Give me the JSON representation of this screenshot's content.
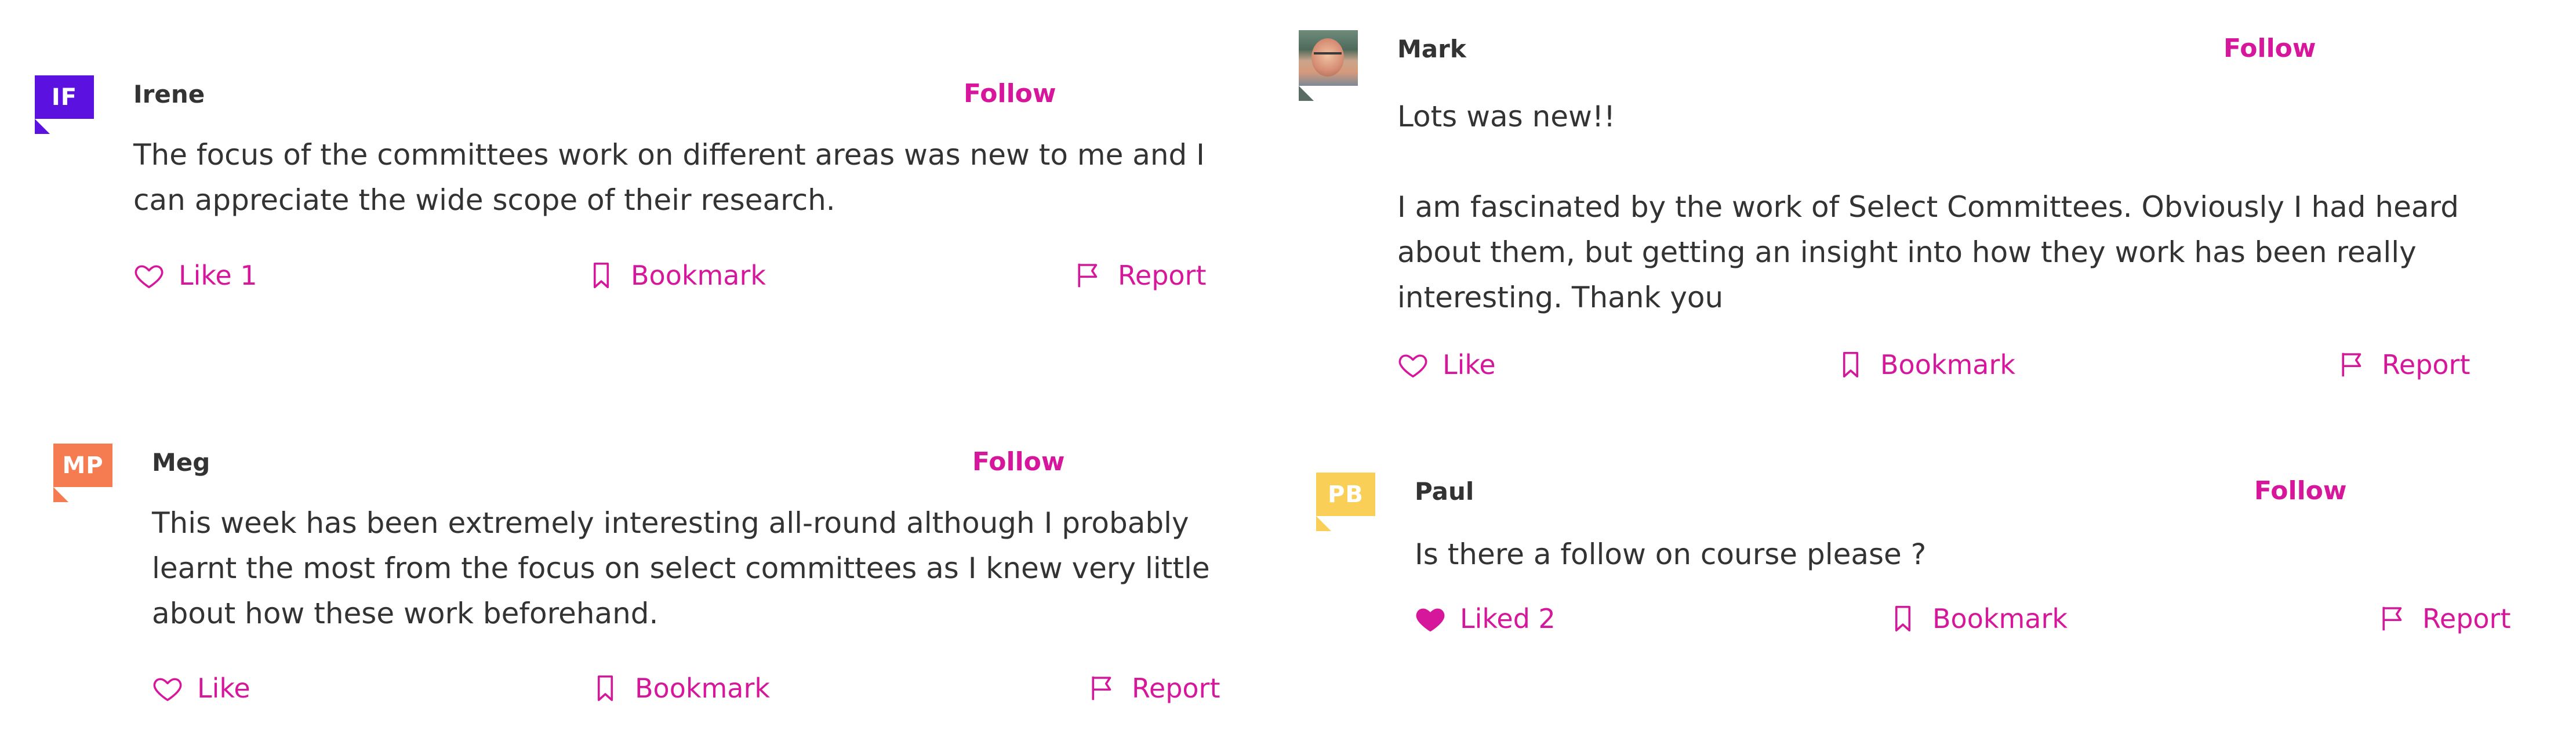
{
  "comments": [
    {
      "author": "Irene",
      "initials": "IF",
      "avatar_color": "#5b12e0",
      "follow_label": "Follow",
      "paragraphs": [
        "The focus of the committees work on different areas was new to me and I can appreciate the wide scope of their research."
      ],
      "like_label": "Like 1",
      "liked": false,
      "bookmark_label": "Bookmark",
      "report_label": "Report"
    },
    {
      "author": "Meg",
      "initials": "MP",
      "avatar_color": "#f47c50",
      "follow_label": "Follow",
      "paragraphs": [
        "This week has been extremely interesting all-round although I probably learnt the most from the focus on select committees as I knew very little about how these work beforehand."
      ],
      "like_label": "Like",
      "liked": false,
      "bookmark_label": "Bookmark",
      "report_label": "Report"
    },
    {
      "author": "Mark",
      "initials": "",
      "avatar_color": "",
      "follow_label": "Follow",
      "paragraphs": [
        "Lots was new!!",
        "I am fascinated by the work of Select Committees. Obviously I had heard about them, but getting an insight into how they work has been really interesting. Thank you"
      ],
      "like_label": "Like",
      "liked": false,
      "bookmark_label": "Bookmark",
      "report_label": "Report"
    },
    {
      "author": "Paul",
      "initials": "PB",
      "avatar_color": "#f9cf57",
      "follow_label": "Follow",
      "paragraphs": [
        "Is there a follow on course please ?"
      ],
      "like_label": "Liked 2",
      "liked": true,
      "bookmark_label": "Bookmark",
      "report_label": "Report"
    }
  ],
  "colors": {
    "accent": "#d6169b",
    "text": "#333333"
  },
  "icons": {
    "like": "heart-outline-icon",
    "liked": "heart-filled-icon",
    "bookmark": "bookmark-icon",
    "report": "flag-icon"
  }
}
